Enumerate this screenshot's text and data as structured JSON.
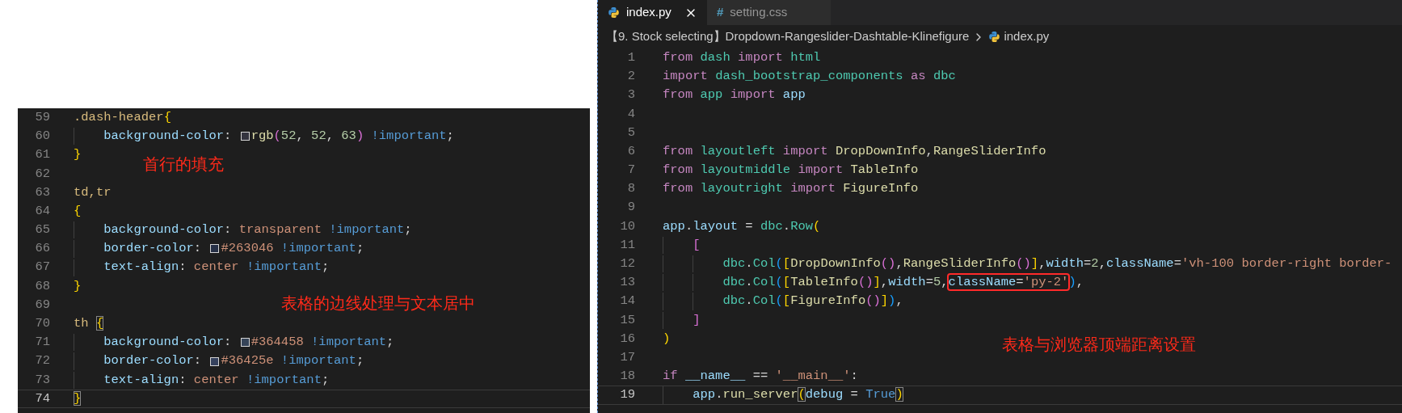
{
  "css_editor": {
    "lines": [
      {
        "number": "59",
        "current": false,
        "tokens": [
          {
            "kind": "sel",
            "text": ".dash-header"
          },
          {
            "kind": "brace",
            "text": "{"
          }
        ]
      },
      {
        "number": "60",
        "current": false,
        "tokens": [
          {
            "kind": "prop",
            "text": "    background-color"
          },
          {
            "kind": "punct",
            "text": ": "
          },
          {
            "kind": "swatch",
            "color": "#34343f"
          },
          {
            "kind": "fn",
            "text": "rgb"
          },
          {
            "kind": "paren",
            "text": "("
          },
          {
            "kind": "num",
            "text": "52"
          },
          {
            "kind": "punct",
            "text": ", "
          },
          {
            "kind": "num",
            "text": "52"
          },
          {
            "kind": "punct",
            "text": ", "
          },
          {
            "kind": "num",
            "text": "63"
          },
          {
            "kind": "paren",
            "text": ")"
          },
          {
            "kind": "imp",
            "text": " !important"
          },
          {
            "kind": "punct",
            "text": ";"
          }
        ]
      },
      {
        "number": "61",
        "current": false,
        "tokens": [
          {
            "kind": "brace",
            "text": "}"
          }
        ]
      },
      {
        "number": "62",
        "current": false
      },
      {
        "number": "63",
        "current": false,
        "tokens": [
          {
            "kind": "sel",
            "text": "td,tr"
          }
        ]
      },
      {
        "number": "64",
        "current": false,
        "tokens": [
          {
            "kind": "brace",
            "text": "{"
          }
        ]
      },
      {
        "number": "65",
        "current": false,
        "tokens": [
          {
            "kind": "prop",
            "text": "    background-color"
          },
          {
            "kind": "punct",
            "text": ": "
          },
          {
            "kind": "val",
            "text": "transparent"
          },
          {
            "kind": "imp",
            "text": " !important"
          },
          {
            "kind": "punct",
            "text": ";"
          }
        ]
      },
      {
        "number": "66",
        "current": false,
        "tokens": [
          {
            "kind": "prop",
            "text": "    border-color"
          },
          {
            "kind": "punct",
            "text": ": "
          },
          {
            "kind": "swatch",
            "color": "#263046"
          },
          {
            "kind": "val",
            "text": "#263046"
          },
          {
            "kind": "imp",
            "text": " !important"
          },
          {
            "kind": "punct",
            "text": ";"
          }
        ]
      },
      {
        "number": "67",
        "current": false,
        "tokens": [
          {
            "kind": "prop",
            "text": "    text-align"
          },
          {
            "kind": "punct",
            "text": ": "
          },
          {
            "kind": "val",
            "text": "center"
          },
          {
            "kind": "imp",
            "text": " !important"
          },
          {
            "kind": "punct",
            "text": ";"
          }
        ]
      },
      {
        "number": "68",
        "current": false,
        "tokens": [
          {
            "kind": "brace",
            "text": "}"
          }
        ]
      },
      {
        "number": "69",
        "current": false
      },
      {
        "number": "70",
        "current": false,
        "tokens": [
          {
            "kind": "sel",
            "text": "th "
          },
          {
            "kind": "brace",
            "text": "{",
            "matched": true
          }
        ]
      },
      {
        "number": "71",
        "current": false,
        "tokens": [
          {
            "kind": "prop",
            "text": "    background-color"
          },
          {
            "kind": "punct",
            "text": ": "
          },
          {
            "kind": "swatch",
            "color": "#364458"
          },
          {
            "kind": "val",
            "text": "#364458"
          },
          {
            "kind": "imp",
            "text": " !important"
          },
          {
            "kind": "punct",
            "text": ";"
          }
        ]
      },
      {
        "number": "72",
        "current": false,
        "tokens": [
          {
            "kind": "prop",
            "text": "    border-color"
          },
          {
            "kind": "punct",
            "text": ": "
          },
          {
            "kind": "swatch",
            "color": "#36425e"
          },
          {
            "kind": "val",
            "text": "#36425e"
          },
          {
            "kind": "imp",
            "text": " !important"
          },
          {
            "kind": "punct",
            "text": ";"
          }
        ]
      },
      {
        "number": "73",
        "current": false,
        "tokens": [
          {
            "kind": "prop",
            "text": "    text-align"
          },
          {
            "kind": "punct",
            "text": ": "
          },
          {
            "kind": "val",
            "text": "center"
          },
          {
            "kind": "imp",
            "text": " !important"
          },
          {
            "kind": "punct",
            "text": ";"
          }
        ]
      },
      {
        "number": "74",
        "current": true,
        "tokens": [
          {
            "kind": "brace",
            "text": "}",
            "matched": true
          }
        ]
      }
    ],
    "annotations": [
      "首行的填充",
      "表格的边线处理与文本居中"
    ]
  },
  "py_editor": {
    "tabs": [
      {
        "label": "index.py",
        "selected": true,
        "kind": "python",
        "closable": true
      },
      {
        "label": "setting.css",
        "selected": false,
        "kind": "css",
        "glyph": "#",
        "closable": false
      }
    ],
    "breadcrumb": {
      "folder": "【9. Stock selecting】Dropdown-Rangeslider-Dashtable-Klinefigure",
      "file": "index.py"
    },
    "lines": [
      {
        "number": "1",
        "current": false,
        "tokens": [
          {
            "kind": "kw",
            "text": "from "
          },
          {
            "kind": "mod",
            "text": "dash "
          },
          {
            "kind": "kw",
            "text": "import "
          },
          {
            "kind": "mod",
            "text": "html"
          }
        ]
      },
      {
        "number": "2",
        "current": false,
        "tokens": [
          {
            "kind": "kw",
            "text": "import "
          },
          {
            "kind": "mod",
            "text": "dash_bootstrap_components "
          },
          {
            "kind": "kw",
            "text": "as "
          },
          {
            "kind": "mod",
            "text": "dbc"
          }
        ]
      },
      {
        "number": "3",
        "current": false,
        "tokens": [
          {
            "kind": "kw",
            "text": "from "
          },
          {
            "kind": "mod",
            "text": "app "
          },
          {
            "kind": "kw",
            "text": "import "
          },
          {
            "kind": "var",
            "text": "app"
          }
        ]
      },
      {
        "number": "4",
        "current": false
      },
      {
        "number": "5",
        "current": false
      },
      {
        "number": "6",
        "current": false,
        "tokens": [
          {
            "kind": "kw",
            "text": "from "
          },
          {
            "kind": "mod",
            "text": "layoutleft "
          },
          {
            "kind": "kw",
            "text": "import "
          },
          {
            "kind": "fn",
            "text": "DropDownInfo"
          },
          {
            "kind": "punct",
            "text": ","
          },
          {
            "kind": "fn",
            "text": "RangeSliderInfo"
          }
        ]
      },
      {
        "number": "7",
        "current": false,
        "tokens": [
          {
            "kind": "kw",
            "text": "from "
          },
          {
            "kind": "mod",
            "text": "layoutmiddle "
          },
          {
            "kind": "kw",
            "text": "import "
          },
          {
            "kind": "fn",
            "text": "TableInfo"
          }
        ]
      },
      {
        "number": "8",
        "current": false,
        "tokens": [
          {
            "kind": "kw",
            "text": "from "
          },
          {
            "kind": "mod",
            "text": "layoutright "
          },
          {
            "kind": "kw",
            "text": "import "
          },
          {
            "kind": "fn",
            "text": "FigureInfo"
          }
        ]
      },
      {
        "number": "9",
        "current": false
      },
      {
        "number": "10",
        "current": false,
        "tokens": [
          {
            "kind": "var",
            "text": "app"
          },
          {
            "kind": "punct",
            "text": "."
          },
          {
            "kind": "var",
            "text": "layout"
          },
          {
            "kind": "punct",
            "text": " = "
          },
          {
            "kind": "mod",
            "text": "dbc"
          },
          {
            "kind": "punct",
            "text": "."
          },
          {
            "kind": "mod",
            "text": "Row"
          },
          {
            "kind": "br1",
            "text": "("
          }
        ]
      },
      {
        "number": "11",
        "current": false,
        "tokens": [
          {
            "kind": "br2",
            "text": "    ["
          }
        ]
      },
      {
        "number": "12",
        "current": false,
        "tokens": [
          {
            "kind": "mod",
            "text": "        dbc"
          },
          {
            "kind": "punct",
            "text": "."
          },
          {
            "kind": "mod",
            "text": "Col"
          },
          {
            "kind": "br3",
            "text": "("
          },
          {
            "kind": "br1",
            "text": "["
          },
          {
            "kind": "fn",
            "text": "DropDownInfo"
          },
          {
            "kind": "br2",
            "text": "()"
          },
          {
            "kind": "punct",
            "text": ","
          },
          {
            "kind": "fn",
            "text": "RangeSliderInfo"
          },
          {
            "kind": "br2",
            "text": "()"
          },
          {
            "kind": "br1",
            "text": "]"
          },
          {
            "kind": "punct",
            "text": ","
          },
          {
            "kind": "var",
            "text": "width"
          },
          {
            "kind": "punct",
            "text": "="
          },
          {
            "kind": "num",
            "text": "2"
          },
          {
            "kind": "punct",
            "text": ","
          },
          {
            "kind": "var",
            "text": "className"
          },
          {
            "kind": "punct",
            "text": "="
          },
          {
            "kind": "str",
            "text": "'vh-100 border-right border-"
          }
        ]
      },
      {
        "number": "13",
        "current": false,
        "tokens": [
          {
            "kind": "mod",
            "text": "        dbc"
          },
          {
            "kind": "punct",
            "text": "."
          },
          {
            "kind": "mod",
            "text": "Col"
          },
          {
            "kind": "br3",
            "text": "("
          },
          {
            "kind": "br1",
            "text": "["
          },
          {
            "kind": "fn",
            "text": "TableInfo"
          },
          {
            "kind": "br2",
            "text": "()"
          },
          {
            "kind": "br1",
            "text": "]"
          },
          {
            "kind": "punct",
            "text": ","
          },
          {
            "kind": "var",
            "text": "width"
          },
          {
            "kind": "punct",
            "text": "="
          },
          {
            "kind": "num",
            "text": "5"
          },
          {
            "kind": "punct",
            "text": ","
          },
          {
            "kind": "var",
            "text": "className",
            "boxed": true
          },
          {
            "kind": "punct",
            "text": "=",
            "boxed": true
          },
          {
            "kind": "str",
            "text": "'py-2'",
            "boxed": true
          },
          {
            "kind": "br3",
            "text": ")"
          },
          {
            "kind": "punct",
            "text": ","
          }
        ]
      },
      {
        "number": "14",
        "current": false,
        "tokens": [
          {
            "kind": "mod",
            "text": "        dbc"
          },
          {
            "kind": "punct",
            "text": "."
          },
          {
            "kind": "mod",
            "text": "Col"
          },
          {
            "kind": "br3",
            "text": "("
          },
          {
            "kind": "br1",
            "text": "["
          },
          {
            "kind": "fn",
            "text": "FigureInfo"
          },
          {
            "kind": "br2",
            "text": "()"
          },
          {
            "kind": "br1",
            "text": "]"
          },
          {
            "kind": "br3",
            "text": ")"
          },
          {
            "kind": "punct",
            "text": ","
          }
        ]
      },
      {
        "number": "15",
        "current": false,
        "tokens": [
          {
            "kind": "br2",
            "text": "    ]"
          }
        ]
      },
      {
        "number": "16",
        "current": false,
        "tokens": [
          {
            "kind": "br1",
            "text": ")"
          }
        ]
      },
      {
        "number": "17",
        "current": false
      },
      {
        "number": "18",
        "current": false,
        "tokens": [
          {
            "kind": "kw",
            "text": "if "
          },
          {
            "kind": "var",
            "text": "__name__"
          },
          {
            "kind": "punct",
            "text": " == "
          },
          {
            "kind": "str",
            "text": "'__main__'"
          },
          {
            "kind": "punct",
            "text": ":"
          }
        ]
      },
      {
        "number": "19",
        "current": true,
        "tokens": [
          {
            "kind": "var",
            "text": "    app"
          },
          {
            "kind": "punct",
            "text": "."
          },
          {
            "kind": "fn",
            "text": "run_server"
          },
          {
            "kind": "br1",
            "text": "(",
            "matched": true
          },
          {
            "kind": "var",
            "text": "debug"
          },
          {
            "kind": "punct",
            "text": " = "
          },
          {
            "kind": "const",
            "text": "True"
          },
          {
            "kind": "br1",
            "text": ")",
            "matched": true
          }
        ]
      }
    ],
    "annotations": [
      "表格与浏览器顶端距离设置"
    ]
  }
}
